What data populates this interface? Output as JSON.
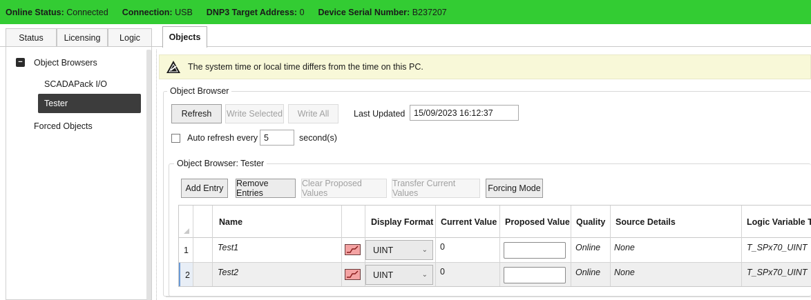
{
  "status_bar": {
    "online_status_label": "Online Status:",
    "online_status_value": "Connected",
    "connection_label": "Connection:",
    "connection_value": "USB",
    "dnp3_label": "DNP3 Target Address:",
    "dnp3_value": "0",
    "serial_label": "Device Serial Number:",
    "serial_value": "B237207",
    "color": "#33cc33"
  },
  "tabs": [
    "Status",
    "Licensing",
    "Logic",
    "Objects"
  ],
  "active_tab": "Objects",
  "tree": {
    "root": "Object Browsers",
    "children": [
      "SCADAPack I/O",
      "Tester"
    ],
    "selected": "Tester",
    "forced": "Forced Objects"
  },
  "warning": {
    "text": "The system time or local time differs from the time on this PC.",
    "icon": "warning-icon"
  },
  "object_browser": {
    "title": "Object Browser",
    "refresh_label": "Refresh",
    "write_selected_label": "Write Selected",
    "write_all_label": "Write All",
    "last_updated_label": "Last Updated",
    "last_updated_value": "15/09/2023 16:12:37",
    "auto_refresh_label": "Auto refresh every",
    "auto_refresh_value": "5",
    "seconds_label": "second(s)"
  },
  "tester_group": {
    "title": "Object Browser: Tester",
    "add_entry_label": "Add Entry",
    "remove_entries_label": "Remove Entries",
    "clear_proposed_label": "Clear Proposed Values",
    "transfer_current_label": "Transfer Current Values",
    "forcing_mode_label": "Forcing Mode"
  },
  "table": {
    "headers": {
      "name": "Name",
      "display_format": "Display Format",
      "current_value": "Current Value",
      "proposed_value": "Proposed Value",
      "quality": "Quality",
      "source_details": "Source Details",
      "logic_variable_type": "Logic Variable T"
    },
    "rows": [
      {
        "num": "1",
        "name": "Test1",
        "display_format": "UINT",
        "current_value": "0",
        "quality": "Online",
        "source": "None",
        "logic_type": "T_SPx70_UINT"
      },
      {
        "num": "2",
        "name": "Test2",
        "display_format": "UINT",
        "current_value": "0",
        "quality": "Online",
        "source": "None",
        "logic_type": "T_SPx70_UINT"
      }
    ]
  }
}
